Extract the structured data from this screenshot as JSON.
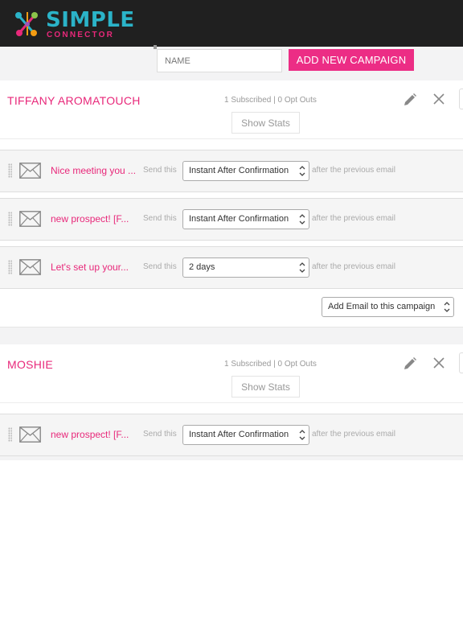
{
  "brand": {
    "line1": "SIMPLE",
    "line2": "CONNECTOR",
    "accent": "#ec2d85",
    "teal": "#2bb3c8"
  },
  "toolbar": {
    "name_placeholder": "NAME",
    "add_campaign_label": "ADD NEW CAMPAIGN"
  },
  "campaigns": [
    {
      "name": "TIFFANY AROMATOUCH",
      "subscribed": "1 Subscribed | 0 Opt Outs",
      "show_stats": "Show Stats",
      "emails": [
        {
          "subject": "Nice meeting you ...",
          "send_label": "Send this",
          "delay": "Instant After Confirmation",
          "after_label": "after the previous email"
        },
        {
          "subject": "new prospect! [F...",
          "send_label": "Send this",
          "delay": "Instant After Confirmation",
          "after_label": "after the previous email"
        },
        {
          "subject": "Let's set up your...",
          "send_label": "Send this",
          "delay": "2 days",
          "after_label": "after the previous email"
        }
      ],
      "add_email": "Add Email to this campaign"
    },
    {
      "name": "MOSHIE",
      "subscribed": "1 Subscribed | 0 Opt Outs",
      "show_stats": "Show Stats",
      "emails": [
        {
          "subject": "new prospect! [F...",
          "send_label": "Send this",
          "delay": "Instant After Confirmation",
          "after_label": "after the previous email"
        }
      ]
    }
  ]
}
